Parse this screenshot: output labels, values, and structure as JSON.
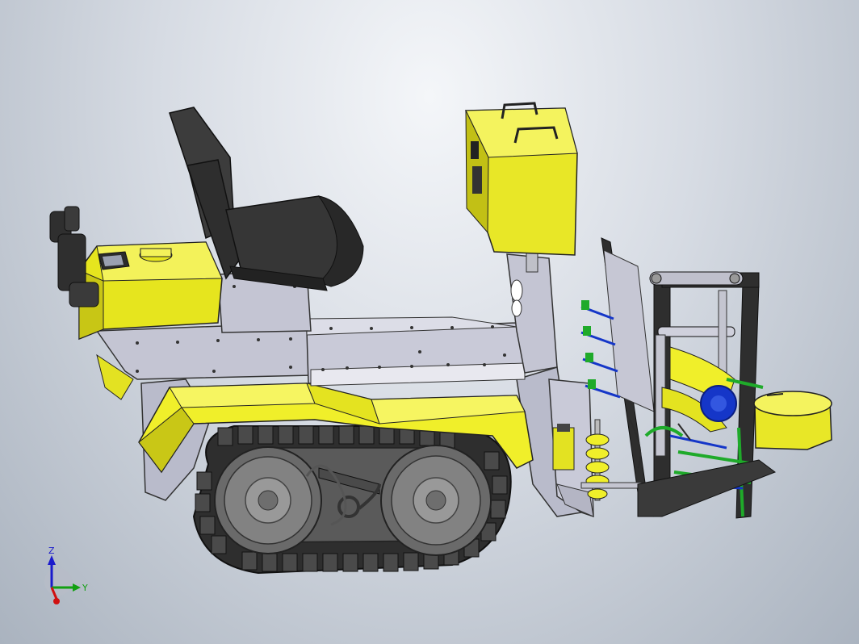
{
  "viewport": {
    "background_top": "#f4f6f9",
    "background_bottom": "#aab3bf"
  },
  "colors": {
    "yellow": "#f0ef2a",
    "yellow_dark": "#b6b40f",
    "metal": "#c9cad6",
    "metal_dark": "#8e90a0",
    "black": "#2b2b2b",
    "track": "#3a3a3a",
    "wheel": "#7b7b7b",
    "green": "#1faa2a",
    "blue": "#1536c8"
  },
  "triad": {
    "z_label": "Z",
    "y_label": "Y",
    "z_color": "#1a1acc",
    "y_color": "#12a012",
    "x_color": "#d01010"
  }
}
